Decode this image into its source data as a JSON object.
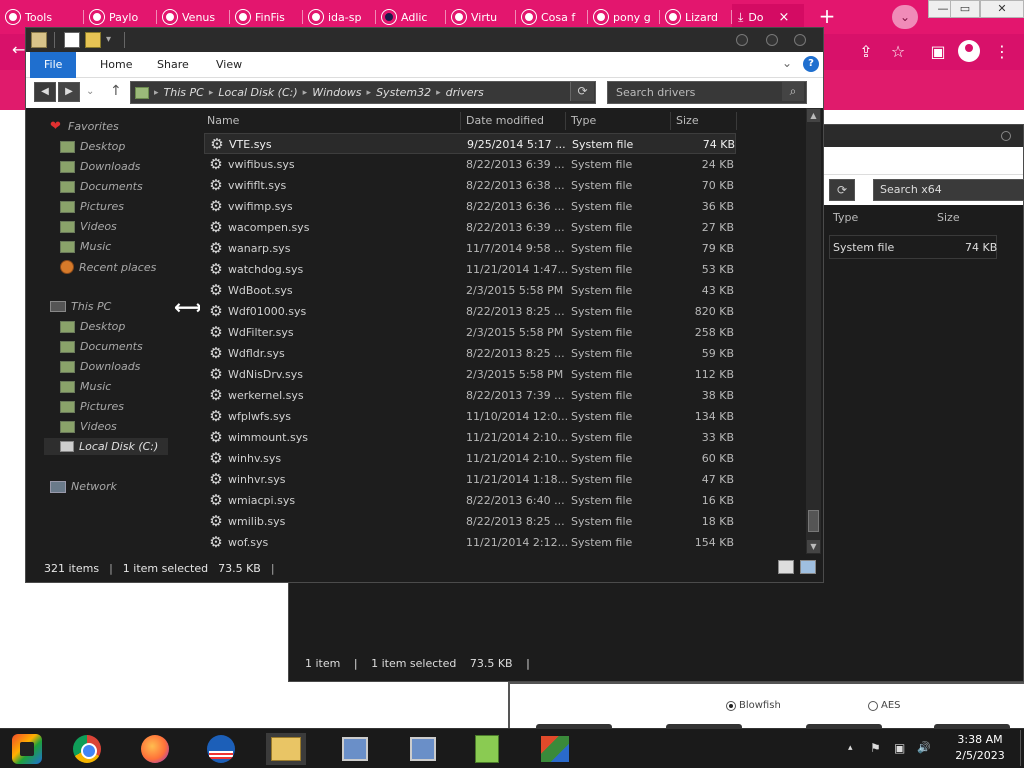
{
  "browser": {
    "tabs": [
      {
        "label": "Tools"
      },
      {
        "label": "Paylo"
      },
      {
        "label": "Venus"
      },
      {
        "label": "FinFis"
      },
      {
        "label": "ida-sp"
      },
      {
        "label": "Adlic"
      },
      {
        "label": "Virtu"
      },
      {
        "label": "Cosa f"
      },
      {
        "label": "pony g"
      },
      {
        "label": "Lizard"
      },
      {
        "label": "Do"
      }
    ],
    "new_tab_glyph": "+",
    "dropdown_glyph": "⌄",
    "close_glyph": "×",
    "window_controls": [
      "—",
      "▭",
      "✕"
    ],
    "accent_color": "#e3166e"
  },
  "bg_window": {
    "search_placeholder": "Search x64",
    "refresh_glyph": "⟳",
    "columns": {
      "type": "Type",
      "size": "Size"
    },
    "row": {
      "type": "System file",
      "size": "74 KB"
    },
    "status": {
      "items": "1 item",
      "pipe": "|",
      "selected": "1 item selected",
      "size": "73.5 KB"
    }
  },
  "radio_panel": {
    "options": [
      {
        "label": "Blowfish",
        "selected": true
      },
      {
        "label": "AES",
        "selected": false
      }
    ]
  },
  "explorer": {
    "ribbon_tabs": {
      "file": "File",
      "home": "Home",
      "share": "Share",
      "view": "View"
    },
    "ribbon_chevron": "⌄",
    "help_glyph": "?",
    "nav": {
      "back": "◀",
      "forward": "▶",
      "recent": "⌄",
      "up": "↑"
    },
    "breadcrumb": [
      "This PC",
      "Local Disk (C:)",
      "Windows",
      "System32",
      "drivers"
    ],
    "breadcrumb_sep": "▸",
    "refresh_glyph": "⟳",
    "search_placeholder": "Search drivers",
    "search_glyph": "⌕",
    "sidebar": {
      "favorites_label": "Favorites",
      "favorites": [
        "Desktop",
        "Downloads",
        "Documents",
        "Pictures",
        "Videos",
        "Music",
        "Recent places"
      ],
      "thispc_label": "This PC",
      "thispc": [
        "Desktop",
        "Documents",
        "Downloads",
        "Music",
        "Pictures",
        "Videos",
        "Local Disk (C:)"
      ],
      "network_label": "Network"
    },
    "columns": {
      "name": "Name",
      "date": "Date modified",
      "type": "Type",
      "size": "Size"
    },
    "files": [
      {
        "name": "VTE.sys",
        "date": "9/25/2014 5:17 ...",
        "type": "System file",
        "size": "74 KB"
      },
      {
        "name": "vwifibus.sys",
        "date": "8/22/2013 6:39 ...",
        "type": "System file",
        "size": "24 KB"
      },
      {
        "name": "vwififlt.sys",
        "date": "8/22/2013 6:38 ...",
        "type": "System file",
        "size": "70 KB"
      },
      {
        "name": "vwifimp.sys",
        "date": "8/22/2013 6:36 ...",
        "type": "System file",
        "size": "36 KB"
      },
      {
        "name": "wacompen.sys",
        "date": "8/22/2013 6:39 ...",
        "type": "System file",
        "size": "27 KB"
      },
      {
        "name": "wanarp.sys",
        "date": "11/7/2014 9:58 ...",
        "type": "System file",
        "size": "79 KB"
      },
      {
        "name": "watchdog.sys",
        "date": "11/21/2014 1:47...",
        "type": "System file",
        "size": "53 KB"
      },
      {
        "name": "WdBoot.sys",
        "date": "2/3/2015 5:58 PM",
        "type": "System file",
        "size": "43 KB"
      },
      {
        "name": "Wdf01000.sys",
        "date": "8/22/2013 8:25 ...",
        "type": "System file",
        "size": "820 KB"
      },
      {
        "name": "WdFilter.sys",
        "date": "2/3/2015 5:58 PM",
        "type": "System file",
        "size": "258 KB"
      },
      {
        "name": "Wdfldr.sys",
        "date": "8/22/2013 8:25 ...",
        "type": "System file",
        "size": "59 KB"
      },
      {
        "name": "WdNisDrv.sys",
        "date": "2/3/2015 5:58 PM",
        "type": "System file",
        "size": "112 KB"
      },
      {
        "name": "werkernel.sys",
        "date": "8/22/2013 7:39 ...",
        "type": "System file",
        "size": "38 KB"
      },
      {
        "name": "wfplwfs.sys",
        "date": "11/10/2014 12:0...",
        "type": "System file",
        "size": "134 KB"
      },
      {
        "name": "wimmount.sys",
        "date": "11/21/2014 2:10...",
        "type": "System file",
        "size": "33 KB"
      },
      {
        "name": "winhv.sys",
        "date": "11/21/2014 2:10...",
        "type": "System file",
        "size": "60 KB"
      },
      {
        "name": "winhvr.sys",
        "date": "11/21/2014 1:18...",
        "type": "System file",
        "size": "47 KB"
      },
      {
        "name": "wmiacpi.sys",
        "date": "8/22/2013 6:40 ...",
        "type": "System file",
        "size": "16 KB"
      },
      {
        "name": "wmilib.sys",
        "date": "8/22/2013 8:25 ...",
        "type": "System file",
        "size": "18 KB"
      },
      {
        "name": "wof.sys",
        "date": "11/21/2014 2:12...",
        "type": "System file",
        "size": "154 KB"
      }
    ],
    "status": {
      "count": "321 items",
      "pipe": "|",
      "selected": "1 item selected",
      "size": "73.5 KB"
    },
    "scroll_up": "▲",
    "scroll_down": "▼",
    "file_glyph": "⚙"
  },
  "taskbar": {
    "time": "3:38 AM",
    "date": "2/5/2023",
    "tray_chevron": "▴",
    "flag_glyph": "⚑",
    "network_glyph": "▣",
    "volume_glyph": "🔊"
  }
}
